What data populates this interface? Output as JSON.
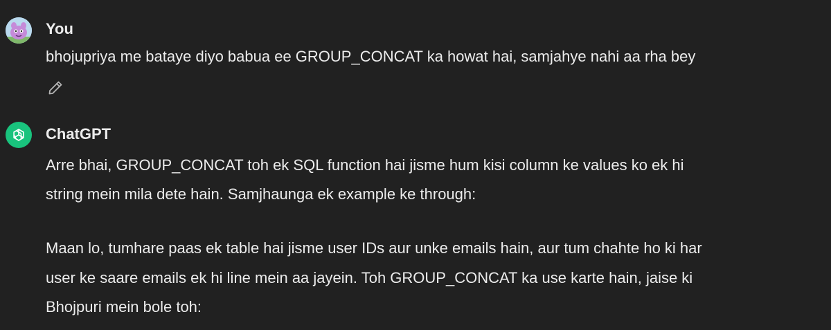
{
  "user_message": {
    "author": "You",
    "text": "bhojupriya me bataye diyo babua ee GROUP_CONCAT ka howat hai, samjahye nahi aa rha bey",
    "avatar_icon": "cartoon-creature-avatar",
    "edit_icon": "pencil-icon"
  },
  "assistant_message": {
    "author": "ChatGPT",
    "avatar_icon": "openai-logo-icon",
    "avatar_color": "#19c37d",
    "paragraphs": [
      {
        "lines": [
          "Arre bhai, GROUP_CONCAT toh ek SQL function hai jisme hum kisi column ke values ko ek hi",
          "string mein mila dete hain. Samjhaunga ek example ke through:"
        ]
      },
      {
        "lines": [
          "Maan lo, tumhare paas ek table hai jisme user IDs aur unke emails hain, aur tum chahte ho ki har",
          "user ke saare emails ek hi line mein aa jayein. Toh GROUP_CONCAT ka use karte hain, jaise ki",
          "Bhojpuri mein bole toh:"
        ]
      }
    ]
  },
  "colors": {
    "background": "#212121",
    "text": "#ececec",
    "muted_icon": "#b4b4b4"
  }
}
